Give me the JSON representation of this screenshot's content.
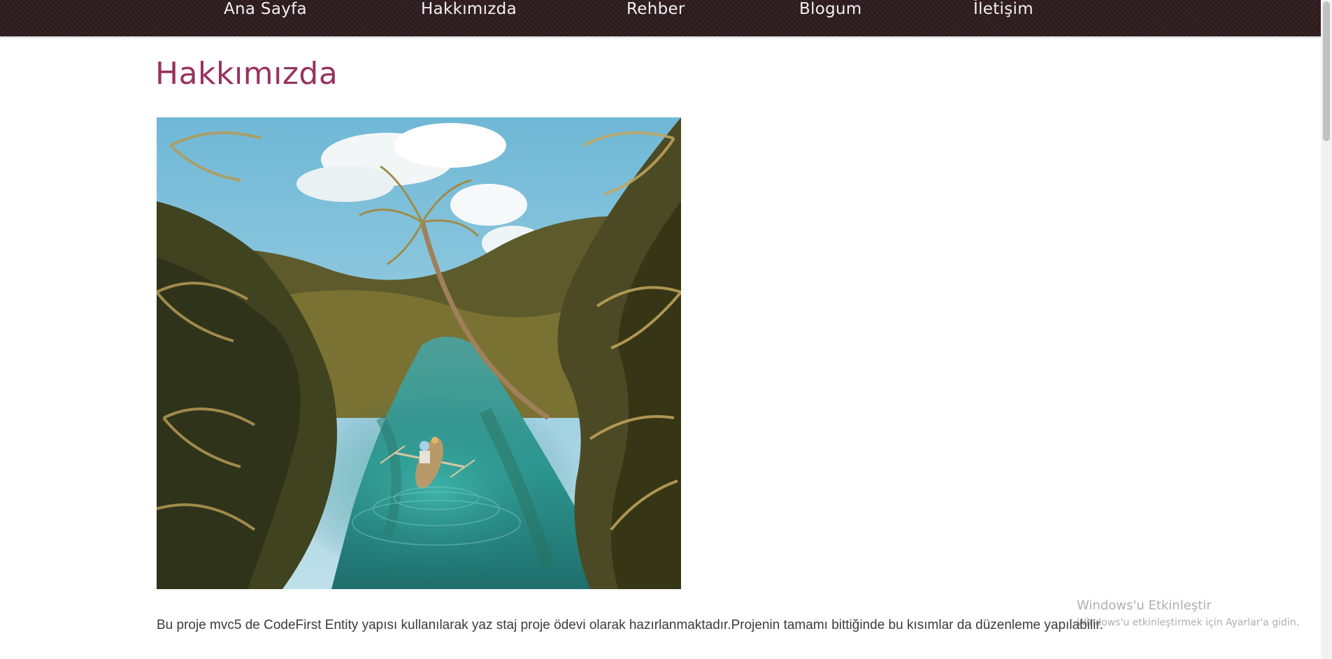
{
  "nav": {
    "items": [
      {
        "label": "Ana Sayfa"
      },
      {
        "label": "Hakkımızda"
      },
      {
        "label": "Rehber"
      },
      {
        "label": "Blogum"
      },
      {
        "label": "İletişim"
      }
    ]
  },
  "main": {
    "title": "Hakkımızda",
    "description": "Bu proje mvc5 de CodeFirst Entity yapısı kullanılarak yaz staj proje ödevi olarak hazırlanmaktadır.Projenin tamamı bittiğinde bu kısımlar da düzenleme yapılabilir."
  },
  "overlay": {
    "activation_title": "Windows'u Etkinleştir",
    "activation_subtitle": "Windows'u etkinleştirmek için Ayarlar'a gidin."
  },
  "colors": {
    "nav_background": "#2f1d1f",
    "nav_text": "#f3efee",
    "title": "#98325f",
    "body_text": "#3b3b3b"
  },
  "icons": {
    "hero": "tropical-river-photo"
  }
}
